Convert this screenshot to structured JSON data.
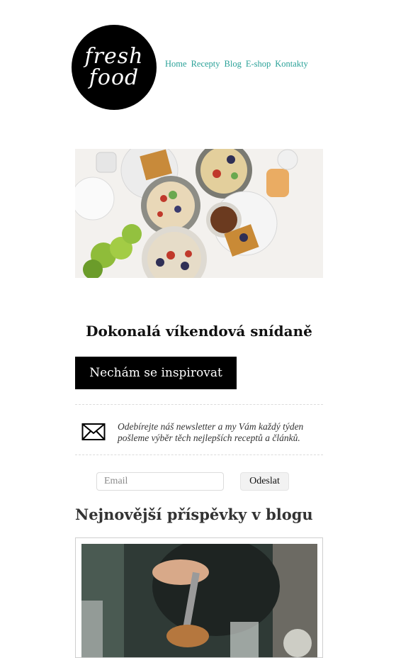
{
  "logo": {
    "line1": "fresh",
    "line2": "food"
  },
  "nav": {
    "items": [
      {
        "label": "Home"
      },
      {
        "label": "Recepty"
      },
      {
        "label": "Blog"
      },
      {
        "label": "E-shop"
      },
      {
        "label": "Kontakty"
      }
    ]
  },
  "hero": {
    "headline": "Dokonalá víkendová snídaně",
    "cta_label": "Nechám se inspirovat"
  },
  "newsletter": {
    "icon": "envelope-icon",
    "text": "Odebírejte náš newsletter a my Vám každý týden pošleme výběr těch nejlepších receptů a článků.",
    "email_placeholder": "Email",
    "submit_label": "Odeslat"
  },
  "blog": {
    "title": "Nejnovější příspěvky v blogu"
  },
  "colors": {
    "accent": "#2aa198",
    "button": "#000000"
  }
}
